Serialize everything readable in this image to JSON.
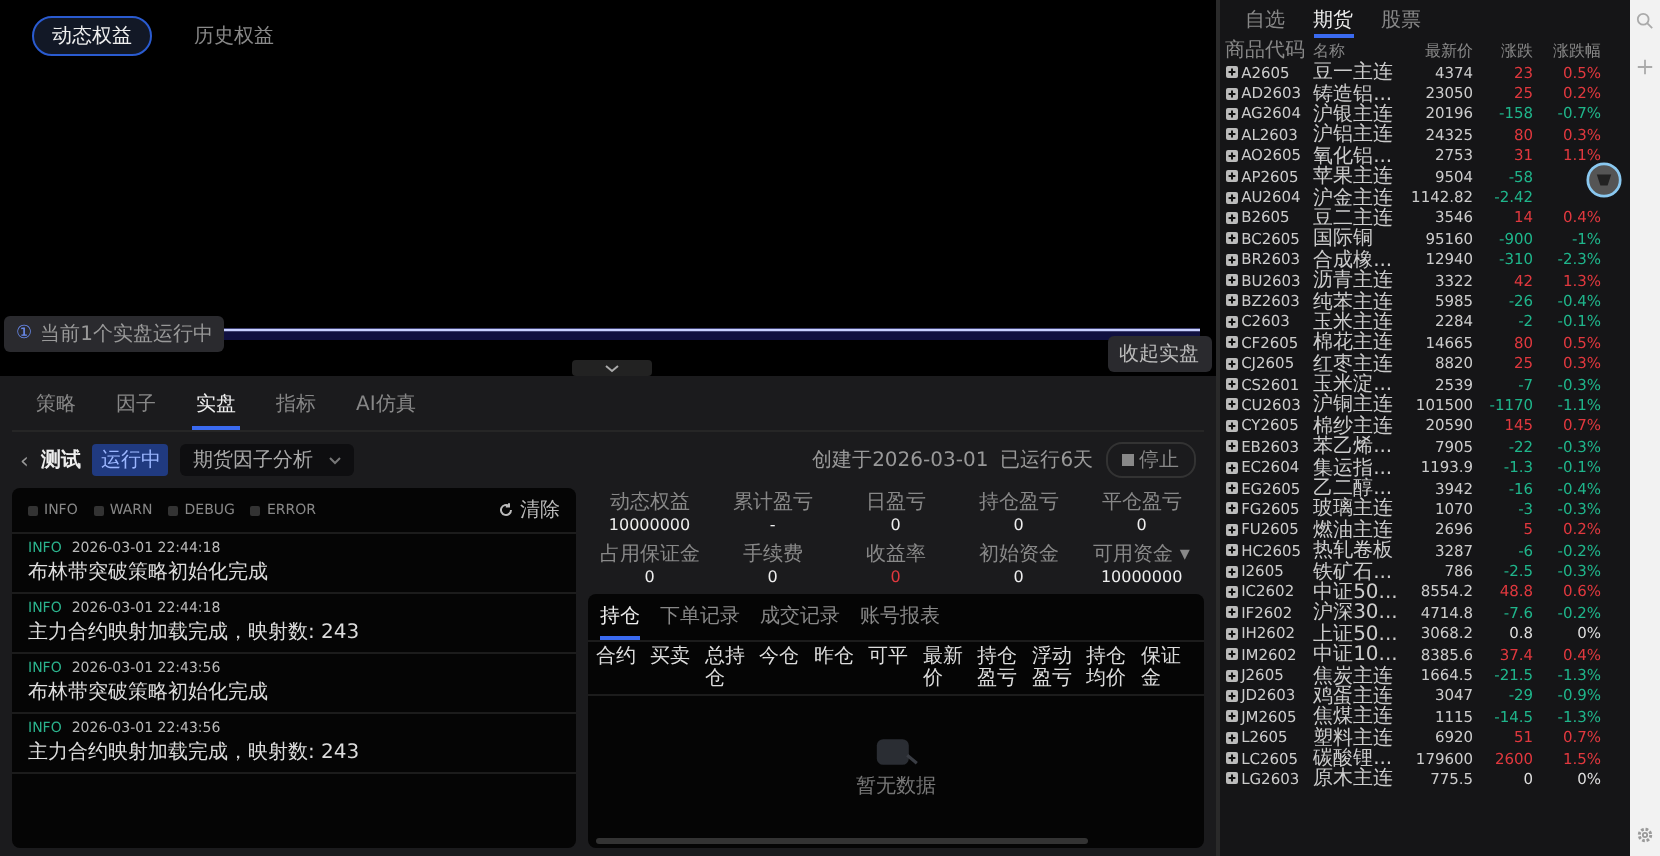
{
  "chart_tabs": [
    {
      "label": "动态权益",
      "selected": true
    },
    {
      "label": "历史权益",
      "selected": false
    }
  ],
  "running_notice": {
    "icon": "①",
    "text": "当前1个实盘运行中"
  },
  "collapse_button": "收起实盘",
  "bottom_tabs": [
    {
      "label": "策略",
      "selected": false
    },
    {
      "label": "因子",
      "selected": false
    },
    {
      "label": "实盘",
      "selected": true
    },
    {
      "label": "指标",
      "selected": false
    },
    {
      "label": "AI仿真",
      "selected": false
    }
  ],
  "strategy": {
    "back": "‹",
    "name": "测试",
    "status": "运行中",
    "select_value": "期货因子分析",
    "created": "创建于2026-03-01",
    "runtime": "已运行6天",
    "stop_button": "停止"
  },
  "log_filters": [
    {
      "label": "INFO",
      "checked": false
    },
    {
      "label": "WARN",
      "checked": false
    },
    {
      "label": "DEBUG",
      "checked": false
    },
    {
      "label": "ERROR",
      "checked": false
    }
  ],
  "clear_button": "清除",
  "logs": [
    {
      "level": "INFO",
      "time": "2026-03-01 22:44:18",
      "message": "布林带突破策略初始化完成"
    },
    {
      "level": "INFO",
      "time": "2026-03-01 22:44:18",
      "message": "主力合约映射加载完成，映射数: 243"
    },
    {
      "level": "INFO",
      "time": "2026-03-01 22:43:56",
      "message": "布林带突破策略初始化完成"
    },
    {
      "level": "INFO",
      "time": "2026-03-01 22:43:56",
      "message": "主力合约映射加载完成，映射数: 243"
    }
  ],
  "stats": [
    {
      "label": "动态权益",
      "value": "10000000",
      "kind": "plain"
    },
    {
      "label": "累计盈亏",
      "value": "-",
      "kind": "plain"
    },
    {
      "label": "日盈亏",
      "value": "0",
      "kind": "plain"
    },
    {
      "label": "持仓盈亏",
      "value": "0",
      "kind": "plain"
    },
    {
      "label": "平仓盈亏",
      "value": "0",
      "kind": "plain"
    },
    {
      "label": "占用保证金",
      "value": "0",
      "kind": "plain"
    },
    {
      "label": "手续费",
      "value": "0",
      "kind": "plain"
    },
    {
      "label": "收益率",
      "value": "0",
      "kind": "up"
    },
    {
      "label": "初始资金",
      "value": "0",
      "kind": "plain"
    },
    {
      "label": "可用资金 ▾",
      "value": "10000000",
      "kind": "plain"
    }
  ],
  "position_tabs": [
    {
      "label": "持仓",
      "selected": true
    },
    {
      "label": "下单记录",
      "selected": false
    },
    {
      "label": "成交记录",
      "selected": false
    },
    {
      "label": "账号报表",
      "selected": false
    }
  ],
  "table": {
    "columns": [
      "合约",
      "买卖",
      "总持仓",
      "今仓",
      "昨仓",
      "可平",
      "最新价",
      "持仓盈亏",
      "浮动盈亏",
      "持仓均价",
      "保证金"
    ],
    "empty_text": "暂无数据"
  },
  "market_tabs": [
    {
      "label": "自选",
      "selected": false
    },
    {
      "label": "期货",
      "selected": true
    },
    {
      "label": "股票",
      "selected": false
    }
  ],
  "market_columns": [
    "商品代码",
    "名称",
    "最新价",
    "涨跌",
    "涨跌幅"
  ],
  "quotes": [
    {
      "code": "A2605",
      "name": "豆一主连",
      "price": "4374",
      "change": "23",
      "pct": "0.5%",
      "kind": "up"
    },
    {
      "code": "AD2603",
      "name": "铸造铝...",
      "price": "23050",
      "change": "25",
      "pct": "0.2%",
      "kind": "up"
    },
    {
      "code": "AG2604",
      "name": "沪银主连",
      "price": "20196",
      "change": "-158",
      "pct": "-0.7%",
      "kind": "down"
    },
    {
      "code": "AL2603",
      "name": "沪铝主连",
      "price": "24325",
      "change": "80",
      "pct": "0.3%",
      "kind": "up"
    },
    {
      "code": "AO2605",
      "name": "氧化铝...",
      "price": "2753",
      "change": "31",
      "pct": "1.1%",
      "kind": "up"
    },
    {
      "code": "AP2605",
      "name": "苹果主连",
      "price": "9504",
      "change": "-58",
      "kind": "down"
    },
    {
      "code": "AU2604",
      "name": "沪金主连",
      "price": "1142.82",
      "change": "-2.42",
      "kind": "down"
    },
    {
      "code": "B2605",
      "name": "豆二主连",
      "price": "3546",
      "change": "14",
      "pct": "0.4%",
      "kind": "up"
    },
    {
      "code": "BC2605",
      "name": "国际铜",
      "price": "95160",
      "change": "-900",
      "pct": "-1%",
      "kind": "down"
    },
    {
      "code": "BR2603",
      "name": "合成橡...",
      "price": "12940",
      "change": "-310",
      "pct": "-2.3%",
      "kind": "down"
    },
    {
      "code": "BU2603",
      "name": "沥青主连",
      "price": "3322",
      "change": "42",
      "pct": "1.3%",
      "kind": "up"
    },
    {
      "code": "BZ2603",
      "name": "纯苯主连",
      "price": "5985",
      "change": "-26",
      "pct": "-0.4%",
      "kind": "down"
    },
    {
      "code": "C2603",
      "name": "玉米主连",
      "price": "2284",
      "change": "-2",
      "pct": "-0.1%",
      "kind": "down"
    },
    {
      "code": "CF2605",
      "name": "棉花主连",
      "price": "14665",
      "change": "80",
      "pct": "0.5%",
      "kind": "up"
    },
    {
      "code": "CJ2605",
      "name": "红枣主连",
      "price": "8820",
      "change": "25",
      "pct": "0.3%",
      "kind": "up"
    },
    {
      "code": "CS2601",
      "name": "玉米淀...",
      "price": "2539",
      "change": "-7",
      "pct": "-0.3%",
      "kind": "down"
    },
    {
      "code": "CU2603",
      "name": "沪铜主连",
      "price": "101500",
      "change": "-1170",
      "pct": "-1.1%",
      "kind": "down"
    },
    {
      "code": "CY2605",
      "name": "棉纱主连",
      "price": "20590",
      "change": "145",
      "pct": "0.7%",
      "kind": "up"
    },
    {
      "code": "EB2603",
      "name": "苯乙烯...",
      "price": "7905",
      "change": "-22",
      "pct": "-0.3%",
      "kind": "down"
    },
    {
      "code": "EC2604",
      "name": "集运指...",
      "price": "1193.9",
      "change": "-1.3",
      "pct": "-0.1%",
      "kind": "down"
    },
    {
      "code": "EG2605",
      "name": "乙二醇...",
      "price": "3942",
      "change": "-16",
      "pct": "-0.4%",
      "kind": "down"
    },
    {
      "code": "FG2605",
      "name": "玻璃主连",
      "price": "1070",
      "change": "-3",
      "pct": "-0.3%",
      "kind": "down"
    },
    {
      "code": "FU2605",
      "name": "燃油主连",
      "price": "2696",
      "change": "5",
      "pct": "0.2%",
      "kind": "up"
    },
    {
      "code": "HC2605",
      "name": "热轧卷板",
      "price": "3287",
      "change": "-6",
      "pct": "-0.2%",
      "kind": "down"
    },
    {
      "code": "I2605",
      "name": "铁矿石...",
      "price": "786",
      "change": "-2.5",
      "pct": "-0.3%",
      "kind": "down"
    },
    {
      "code": "IC2602",
      "name": "中证50...",
      "price": "8554.2",
      "change": "48.8",
      "pct": "0.6%",
      "kind": "up"
    },
    {
      "code": "IF2602",
      "name": "沪深30...",
      "price": "4714.8",
      "change": "-7.6",
      "pct": "-0.2%",
      "kind": "down"
    },
    {
      "code": "IH2602",
      "name": "上证50...",
      "price": "3068.2",
      "change": "0.8",
      "pct": "0%",
      "kind": "flat"
    },
    {
      "code": "IM2602",
      "name": "中证10...",
      "price": "8385.6",
      "change": "37.4",
      "pct": "0.4%",
      "kind": "up"
    },
    {
      "code": "J2605",
      "name": "焦炭主连",
      "price": "1664.5",
      "change": "-21.5",
      "pct": "-1.3%",
      "kind": "down"
    },
    {
      "code": "JD2603",
      "name": "鸡蛋主连",
      "price": "3047",
      "change": "-29",
      "pct": "-0.9%",
      "kind": "down"
    },
    {
      "code": "JM2605",
      "name": "焦煤主连",
      "price": "1115",
      "change": "-14.5",
      "pct": "-1.3%",
      "kind": "down"
    },
    {
      "code": "L2605",
      "name": "塑料主连",
      "price": "6920",
      "change": "51",
      "pct": "0.7%",
      "kind": "up"
    },
    {
      "code": "LC2605",
      "name": "碳酸锂...",
      "price": "179600",
      "change": "2600",
      "pct": "1.5%",
      "kind": "up"
    },
    {
      "code": "LG2603",
      "name": "原木主连",
      "price": "775.5",
      "change": "0",
      "pct": "0%",
      "kind": "flat"
    }
  ]
}
